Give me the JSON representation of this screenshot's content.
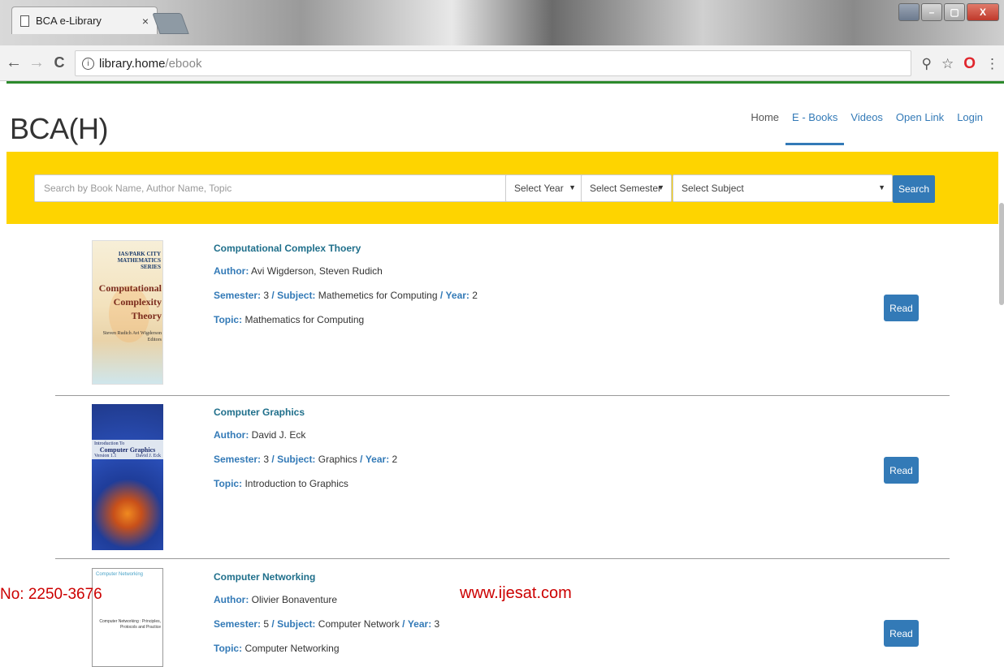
{
  "browser": {
    "tab_title": "BCA e-Library",
    "tab_close": "×",
    "url_host": "library.home",
    "url_path": "/ebook",
    "back": "←",
    "forward": "→",
    "reload": "C",
    "info": "i",
    "zoom_icon": "⚲",
    "star_icon": "☆",
    "opera_icon": "O",
    "menu_icon": "⋮",
    "win_min": "–",
    "win_max": "▢",
    "win_close": "X"
  },
  "site": {
    "brand": "BCA(H)",
    "nav": {
      "home": "Home",
      "ebooks": "E - Books",
      "videos": "Videos",
      "open_link": "Open Link",
      "login": "Login"
    }
  },
  "search": {
    "placeholder": "Search by Book Name, Author Name, Topic",
    "year": "Select Year",
    "semester": "Select Semester",
    "subject": "Select Subject",
    "caret": "▼",
    "button": "Search"
  },
  "labels": {
    "author": "Author:",
    "semester": "Semester:",
    "subject": "Subject:",
    "year": "Year:",
    "topic": "Topic:",
    "sep": "/",
    "read": "Read"
  },
  "books": [
    {
      "title": "Computational Complex Thoery",
      "author": "Avi Wigderson, Steven Rudich",
      "semester": "3",
      "subject": "Mathemetics for Computing",
      "year": "2",
      "topic": "Mathematics for Computing",
      "cover": {
        "series": "IAS/PARK CITY MATHEMATICS SERIES",
        "title": "Computational Complexity Theory",
        "editors": "Steven Rudich Avi Wigderson Editors"
      }
    },
    {
      "title": "Computer Graphics",
      "author": "David J. Eck",
      "semester": "3",
      "subject": "Graphics",
      "year": "2",
      "topic": "Introduction to Graphics",
      "cover": {
        "pre": "Introduction To",
        "title": "Computer Graphics",
        "version": "Version 1.1",
        "author": "David J. Eck"
      }
    },
    {
      "title": "Computer Networking",
      "author": "Olivier Bonaventure",
      "semester": "5",
      "subject": "Computer Network",
      "year": "3",
      "topic": "Computer Networking",
      "cover": {
        "top": "Computer Networking",
        "title": "Computer Networking : Principles, Protocols and Practice"
      }
    }
  ],
  "overlay": {
    "issn": "No: 2250-3676",
    "site": "www.ijesat.com"
  }
}
